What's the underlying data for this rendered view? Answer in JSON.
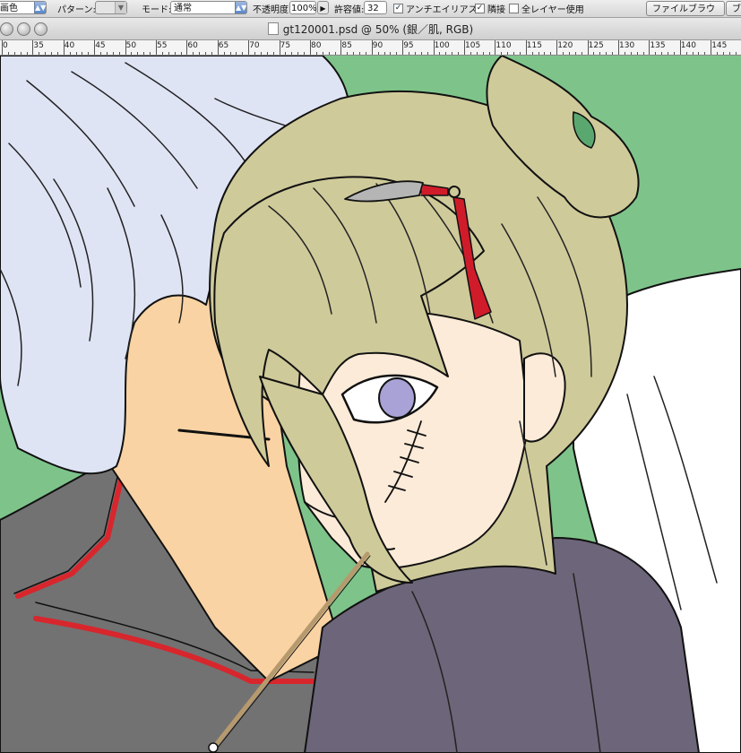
{
  "options_bar": {
    "fill_select": "画色",
    "pattern_label": "パターン:",
    "mode_label": "モード:",
    "mode_value": "通常",
    "opacity_label": "不透明度:",
    "opacity_value": "100%",
    "tolerance_label": "許容値:",
    "tolerance_value": "32",
    "antialias_label": "アンチエイリアス",
    "antialias_checked": true,
    "contiguous_label": "隣接",
    "contiguous_checked": true,
    "all_layers_label": "全レイヤー使用",
    "all_layers_checked": false,
    "file_browser_tab": "ファイルブラウザ",
    "next_tab": "ブ"
  },
  "window": {
    "title": "gt120001.psd @ 50% (銀／肌, RGB)"
  },
  "ruler": {
    "labels": [
      "0",
      "35",
      "40",
      "45",
      "50",
      "55",
      "60",
      "65",
      "70",
      "75",
      "80",
      "85",
      "90",
      "95",
      "100",
      "105",
      "110",
      "115",
      "120",
      "125",
      "130",
      "135",
      "140",
      "145"
    ]
  },
  "colors": {
    "background": "#7ec48a",
    "silver_hair": "#dfe4f5",
    "skin": "#f9d3a3",
    "blonde_hair": "#cfca9a",
    "coat_gray": "#727272",
    "coat_trim": "#d8262d",
    "purple_robe": "#6d6579",
    "eye": "#a9a2d6",
    "tassel": "#d01c2a"
  }
}
